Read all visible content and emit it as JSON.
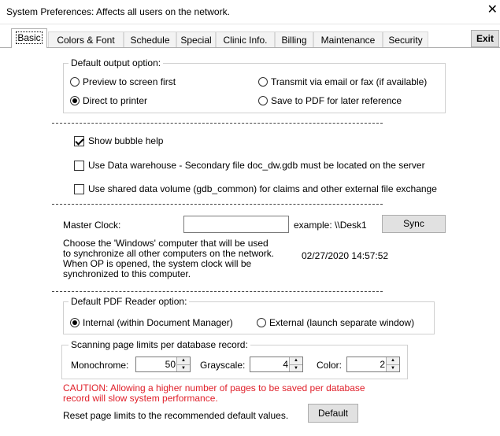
{
  "window": {
    "title": "System Preferences: Affects all users on the network.",
    "close_glyph": "✕"
  },
  "tabs": [
    {
      "label": "Basic",
      "active": true
    },
    {
      "label": "Colors & Font",
      "active": false
    },
    {
      "label": "Schedule",
      "active": false
    },
    {
      "label": "Special",
      "active": false
    },
    {
      "label": "Clinic Info.",
      "active": false
    },
    {
      "label": "Billing",
      "active": false
    },
    {
      "label": "Maintenance",
      "active": false
    },
    {
      "label": "Security",
      "active": false
    }
  ],
  "exit_label": "Exit",
  "output": {
    "group_label": "Default output option:",
    "options": [
      {
        "label": "Preview to screen first",
        "selected": false
      },
      {
        "label": "Transmit via email or fax (if available)",
        "selected": false
      },
      {
        "label": "Direct to printer",
        "selected": true
      },
      {
        "label": "Save to PDF for later reference",
        "selected": false
      }
    ]
  },
  "checks": [
    {
      "label": "Show bubble help",
      "checked": true
    },
    {
      "label": "Use Data warehouse - Secondary file doc_dw.gdb must be located on the server",
      "checked": false
    },
    {
      "label": "Use shared data volume (gdb_common) for claims and other external file exchange",
      "checked": false
    }
  ],
  "clock": {
    "label": "Master Clock:",
    "value": "",
    "example": "example:  \\\\Desk1",
    "sync_label": "Sync",
    "description": [
      "Choose the 'Windows' computer that will be used",
      "to synchronize all other computers on the network.",
      "When OP is opened,  the system clock will be",
      "synchronized to this computer."
    ],
    "timestamp": "02/27/2020 14:57:52"
  },
  "pdf": {
    "group_label": "Default PDF Reader option:",
    "options": [
      {
        "label": "Internal (within Document Manager)",
        "selected": true
      },
      {
        "label": "External (launch separate window)",
        "selected": false
      }
    ]
  },
  "scan": {
    "group_label": "Scanning page limits per database record:",
    "mono_label": "Monochrome:",
    "mono_value": "50",
    "gray_label": "Grayscale:",
    "gray_value": "4",
    "color_label": "Color:",
    "color_value": "2"
  },
  "caution": [
    "CAUTION: Allowing a higher number of pages to be saved per database",
    "record will slow system performance."
  ],
  "reset": {
    "label": "Reset page limits to the recommended default values.",
    "button": "Default"
  },
  "colors": {
    "caution": "#e0202a",
    "button_bg": "#e1e1e1"
  }
}
